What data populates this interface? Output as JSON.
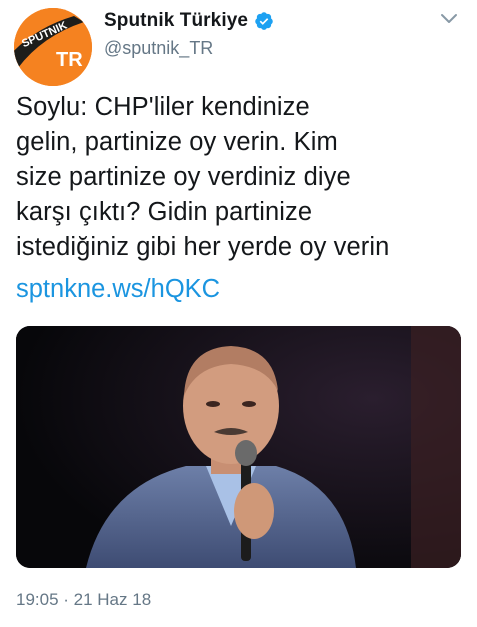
{
  "tweet": {
    "author": {
      "display_name": "Sputnik Türkiye",
      "handle": "@sputnik_TR",
      "verified": true,
      "avatar": {
        "logo_text": "SPUTNIK",
        "logo_badge": "TR",
        "color": "#f58220"
      }
    },
    "text_lines": [
      "Soylu: CHP'liler kendinize",
      "gelin, partinize oy verin. Kim",
      "size partinize oy verdiniz diye",
      "karşı çıktı? Gidin partinize",
      "istediğiniz gibi her yerde oy verin"
    ],
    "link": "sptnkne.ws/hQKC",
    "timestamp": "19:05 · 21 Haz 18",
    "menu_icon": "chevron-down-icon",
    "colors": {
      "link": "#1b95e0",
      "secondary_text": "#657786",
      "verified": "#1da1f2"
    }
  }
}
